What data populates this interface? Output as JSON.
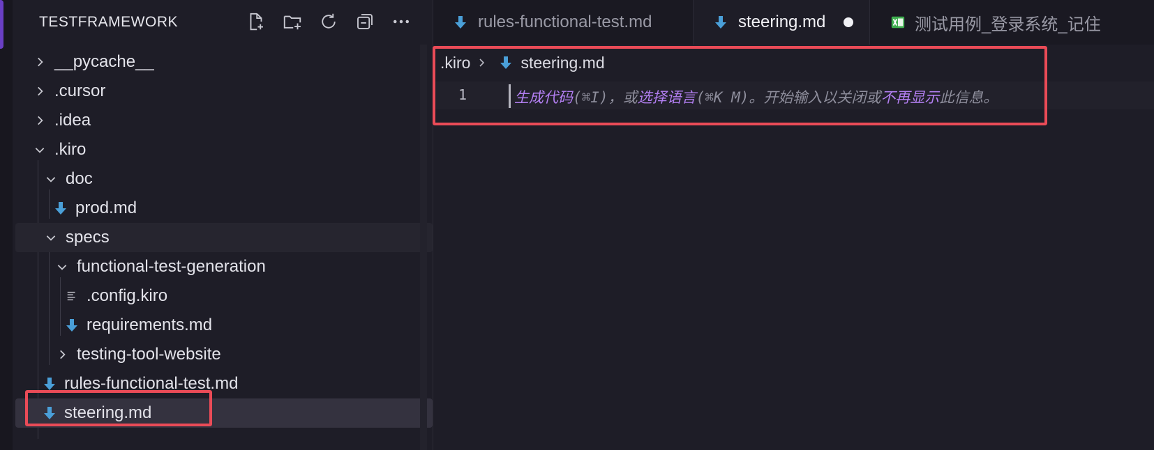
{
  "explorer": {
    "title": "TESTFRAMEWORK",
    "actions": [
      {
        "name": "new-file-icon"
      },
      {
        "name": "new-folder-icon"
      },
      {
        "name": "refresh-icon"
      },
      {
        "name": "collapse-all-icon"
      },
      {
        "name": "more-icon"
      }
    ],
    "items": [
      {
        "label": "__pycache__",
        "type": "folder",
        "expanded": false
      },
      {
        "label": ".cursor",
        "type": "folder",
        "expanded": false
      },
      {
        "label": ".idea",
        "type": "folder",
        "expanded": false
      },
      {
        "label": ".kiro",
        "type": "folder",
        "expanded": true
      },
      {
        "label": "doc",
        "type": "folder",
        "expanded": true
      },
      {
        "label": "prod.md",
        "type": "markdown"
      },
      {
        "label": "specs",
        "type": "folder",
        "expanded": true
      },
      {
        "label": "functional-test-generation",
        "type": "folder",
        "expanded": true
      },
      {
        "label": ".config.kiro",
        "type": "text"
      },
      {
        "label": "requirements.md",
        "type": "markdown"
      },
      {
        "label": "testing-tool-website",
        "type": "folder",
        "expanded": false
      },
      {
        "label": "rules-functional-test.md",
        "type": "markdown"
      },
      {
        "label": "steering.md",
        "type": "markdown",
        "selected": true
      }
    ]
  },
  "tabs": [
    {
      "label": "rules-functional-test.md",
      "icon": "markdown-icon",
      "active": false
    },
    {
      "label": "steering.md",
      "icon": "markdown-icon",
      "active": true,
      "modified": true
    },
    {
      "label": "测试用例_登录系统_记住",
      "icon": "excel-icon",
      "active": false
    }
  ],
  "breadcrumb": {
    "folder": ".kiro",
    "file": "steering.md"
  },
  "editor": {
    "line_number": "1",
    "hint": {
      "generate": "生成代码",
      "generate_key": "(⌘I)，或",
      "select_lang": "选择语言",
      "select_lang_key": "(⌘K M)。开始输入以关闭或",
      "dont_show": "不再显示",
      "tail": "此信息。"
    }
  },
  "colors": {
    "accent_purple": "#b37ff2",
    "markdown_blue": "#4a9fd8",
    "highlight_red": "#ea4b57",
    "excel_green": "#3fae4f"
  }
}
